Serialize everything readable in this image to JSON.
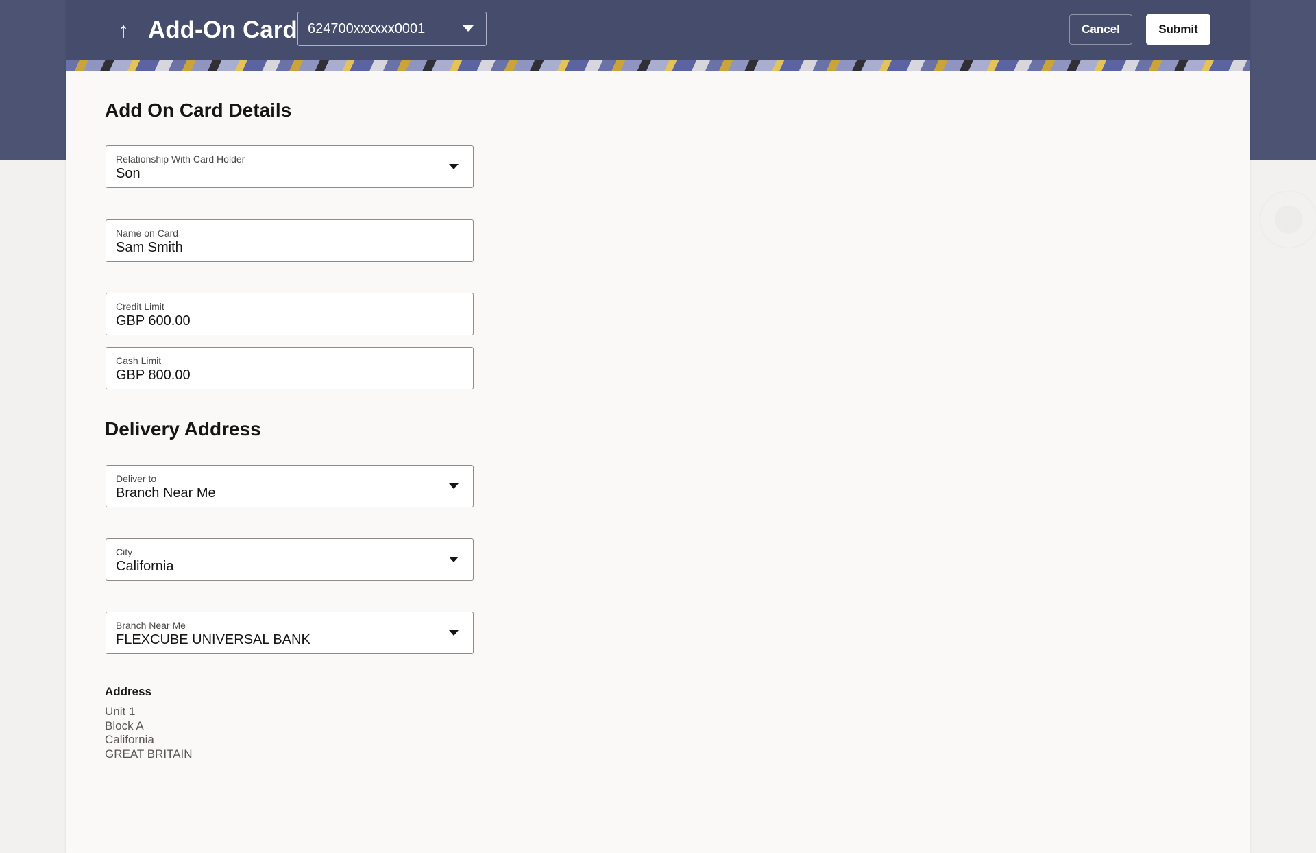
{
  "header": {
    "back_icon": "arrow-up-icon",
    "title": "Add-On Card",
    "card_selector": {
      "value": "624700xxxxxx0001"
    },
    "cancel_label": "Cancel",
    "submit_label": "Submit"
  },
  "sections": {
    "card_details_title": "Add On Card Details",
    "delivery_title": "Delivery Address"
  },
  "fields": {
    "relationship": {
      "label": "Relationship With Card Holder",
      "value": "Son"
    },
    "name_on_card": {
      "label": "Name on Card",
      "value": "Sam Smith"
    },
    "credit_limit": {
      "label": "Credit Limit",
      "value": "GBP 600.00"
    },
    "cash_limit": {
      "label": "Cash Limit",
      "value": "GBP 800.00"
    },
    "deliver_to": {
      "label": "Deliver to",
      "value": "Branch Near Me"
    },
    "city": {
      "label": "City",
      "value": "California"
    },
    "branch": {
      "label": "Branch Near Me",
      "value": "FLEXCUBE UNIVERSAL BANK"
    }
  },
  "address": {
    "label": "Address",
    "lines": [
      "Unit 1",
      "Block A",
      "California",
      "GREAT BRITAIN"
    ]
  },
  "colors": {
    "header_bg": "#464c6b",
    "page_bg": "#faf9f8",
    "accent": "#c9a43b"
  }
}
